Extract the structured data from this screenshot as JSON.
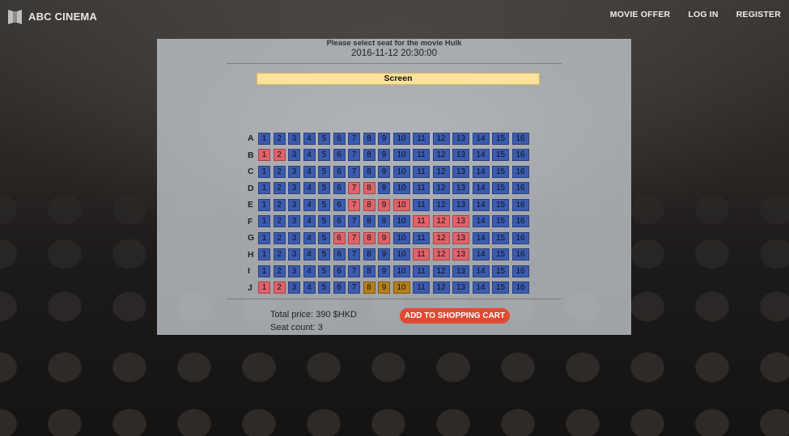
{
  "brand": {
    "name": "ABC CINEMA",
    "icon": "cinema-logo-icon"
  },
  "nav": [
    {
      "label": "MOVIE OFFER"
    },
    {
      "label": "LOG IN"
    },
    {
      "label": "REGISTER"
    }
  ],
  "booking": {
    "movie_prompt": "Please select seat for the movie Hulk",
    "datetime": "2016-11-12 20:30:00",
    "screen_label": "Screen",
    "seat_numbers": [
      1,
      2,
      3,
      4,
      5,
      6,
      7,
      8,
      9,
      10,
      11,
      12,
      13,
      14,
      15,
      16
    ],
    "status_colors": {
      "available": "#3a5bb0",
      "taken": "#e0626a",
      "selected": "#b87f16"
    },
    "rows": [
      {
        "label": "A",
        "taken": [],
        "selected": []
      },
      {
        "label": "B",
        "taken": [
          1,
          2
        ],
        "selected": []
      },
      {
        "label": "C",
        "taken": [],
        "selected": []
      },
      {
        "label": "D",
        "taken": [
          7,
          8
        ],
        "selected": []
      },
      {
        "label": "E",
        "taken": [
          7,
          8,
          9,
          10
        ],
        "selected": []
      },
      {
        "label": "F",
        "taken": [
          11,
          12,
          13
        ],
        "selected": []
      },
      {
        "label": "G",
        "taken": [
          6,
          7,
          8,
          9,
          12,
          13
        ],
        "selected": []
      },
      {
        "label": "H",
        "taken": [
          11,
          12,
          13
        ],
        "selected": []
      },
      {
        "label": "I",
        "taken": [],
        "selected": []
      },
      {
        "label": "J",
        "taken": [
          1,
          2
        ],
        "selected": [
          8,
          9,
          10
        ]
      }
    ],
    "total_price": "Total price: 390 $HKD",
    "seat_count": "Seat count: 3",
    "cart_button": "ADD TO SHOPPING CART"
  }
}
